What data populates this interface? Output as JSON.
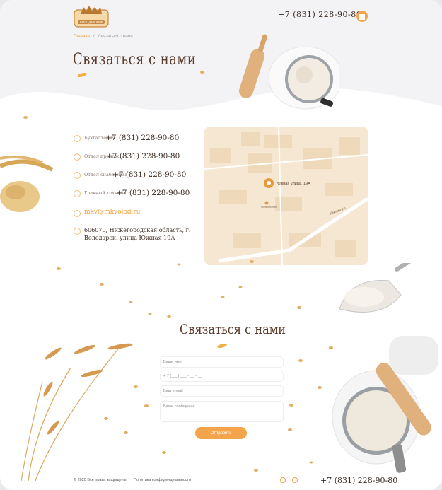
{
  "header": {
    "logo_text": "ВОЛОДАРСКИЙ",
    "phone": "+7 (831) 228-90-80"
  },
  "breadcrumbs": {
    "home": "Главная",
    "separator": "/",
    "current": "Связаться с нами"
  },
  "page_title": "Связаться с нами",
  "contacts": [
    {
      "label": "Бухгалтерия",
      "value": "+7 (831) 228-90-80"
    },
    {
      "label": "Отдел продаж",
      "value": "+7 (831) 228-90-80"
    },
    {
      "label": "Отдел снабжения",
      "value": "+7 (831) 228-90-80"
    },
    {
      "label": "Главный технолог",
      "value": "+7 (831) 228-90-80"
    }
  ],
  "email": "mkv@mkvolod.ru",
  "address": "606070, Нижегородская область, г. Володарск, улица Южная 19А",
  "map": {
    "marker_label": "Южная улица, 19А",
    "street_label": "Южная ул.",
    "poi_label": "Молкомбинат"
  },
  "form": {
    "title": "Связаться с нами",
    "name_placeholder": "Ваше имя",
    "phone_placeholder": "+ 7 (___) ___ - __ - __",
    "email_placeholder": "Ваш e-mail",
    "message_placeholder": "Ваше сообщение",
    "submit_label": "Отправить"
  },
  "footer": {
    "copyright": "© 2020 Все права защищены",
    "separator": "|",
    "policy_link": "Политика конфиденциальности",
    "phone": "+7 (831) 228-90-80"
  },
  "colors": {
    "accent": "#f4a54b",
    "title": "#5a3a2a",
    "text": "#3b2a20",
    "map": "#f6e7d2"
  }
}
